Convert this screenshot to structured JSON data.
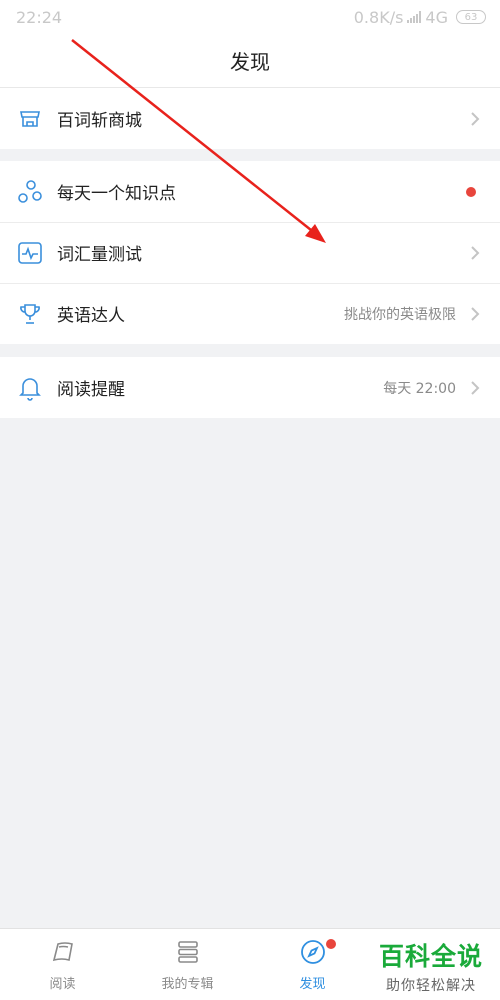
{
  "status_bar": {
    "time": "22:24",
    "network_speed": "0.8K/s",
    "network_type": "4G",
    "battery": "63"
  },
  "header": {
    "title": "发现"
  },
  "groups": [
    {
      "items": [
        {
          "label": "百词斩商城",
          "icon": "store-icon",
          "trailing": "chevron"
        }
      ]
    },
    {
      "items": [
        {
          "label": "每天一个知识点",
          "icon": "molecule-icon",
          "trailing": "red-dot"
        },
        {
          "label": "词汇量测试",
          "icon": "pulse-chart-icon",
          "trailing": "chevron"
        },
        {
          "label": "英语达人",
          "icon": "trophy-icon",
          "extra": "挑战你的英语极限",
          "trailing": "chevron"
        }
      ]
    },
    {
      "items": [
        {
          "label": "阅读提醒",
          "icon": "bell-icon",
          "extra": "每天 22:00",
          "trailing": "chevron"
        }
      ]
    }
  ],
  "tab_bar": {
    "tabs": [
      {
        "label": "阅读",
        "icon": "book-icon",
        "active": false
      },
      {
        "label": "我的专辑",
        "icon": "stack-icon",
        "active": false
      },
      {
        "label": "发现",
        "icon": "compass-icon",
        "active": true,
        "badge": true
      }
    ]
  },
  "watermark": {
    "line1": "百科全说",
    "line2": "助你轻松解决"
  },
  "colors": {
    "accent": "#2f8fe0",
    "badge_red": "#e8453c",
    "watermark_green": "#1aaa3a",
    "annotation_arrow": "#e8221c",
    "background": "#f1f2f4"
  }
}
